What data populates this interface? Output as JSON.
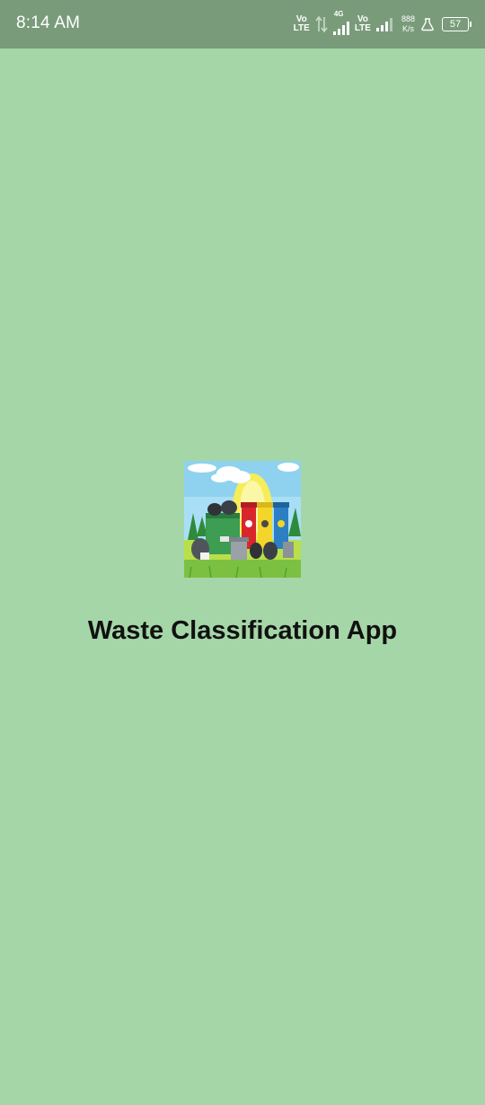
{
  "status_bar": {
    "time": "8:14 AM",
    "volte_1": {
      "top": "Vo",
      "bottom": "LTE"
    },
    "network_type": "4G",
    "volte_2": {
      "top": "Vo",
      "bottom": "LTE"
    },
    "net_speed": {
      "value": "888",
      "unit": "K/s"
    },
    "battery_level": "57"
  },
  "splash": {
    "title": "Waste Classification App",
    "logo_icon": "waste-bins-illustration-icon"
  },
  "colors": {
    "background": "#a5d6a7",
    "status_bar": "#799b7a"
  }
}
